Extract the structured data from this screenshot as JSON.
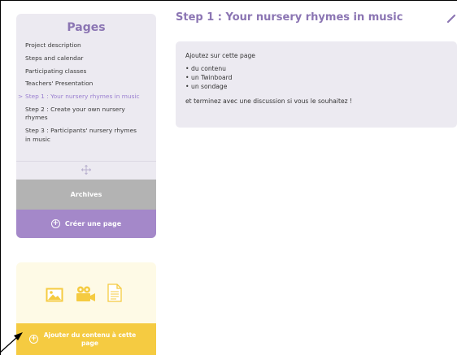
{
  "sidebar": {
    "title": "Pages",
    "items": [
      {
        "label": "Project description",
        "active": false
      },
      {
        "label": "Steps and calendar",
        "active": false
      },
      {
        "label": "Participating classes",
        "active": false
      },
      {
        "label": "Teachers' Presentation",
        "active": false
      },
      {
        "label": "Step 1 : Your nursery rhymes in music",
        "active": true
      },
      {
        "label": "Step 2 : Create your own nursery rhymes",
        "active": false
      },
      {
        "label": "Step 3 : Participants' nursery rhymes in music",
        "active": false
      }
    ],
    "archives_label": "Archives",
    "create_page_label": "Créer une page"
  },
  "content_panel": {
    "icons": [
      "image-icon",
      "video-camera-icon",
      "document-icon"
    ],
    "add_content_label": "Ajouter du contenu à cette page"
  },
  "main": {
    "title": "Step 1 : Your nursery rhymes in music",
    "intro": "Ajoutez sur cette page",
    "bullets": [
      "du contenu",
      "un Twinboard",
      "un sondage"
    ],
    "outro": "et terminez avec une discussion si vous le souhaitez !"
  },
  "colors": {
    "accent_purple": "#8b75b3",
    "create_button": "#a488c9",
    "archives_button": "#b3b3b3",
    "add_content_button": "#f5cb41",
    "panel_background": "#eceaf1",
    "content_panel_background": "#fefae6"
  }
}
